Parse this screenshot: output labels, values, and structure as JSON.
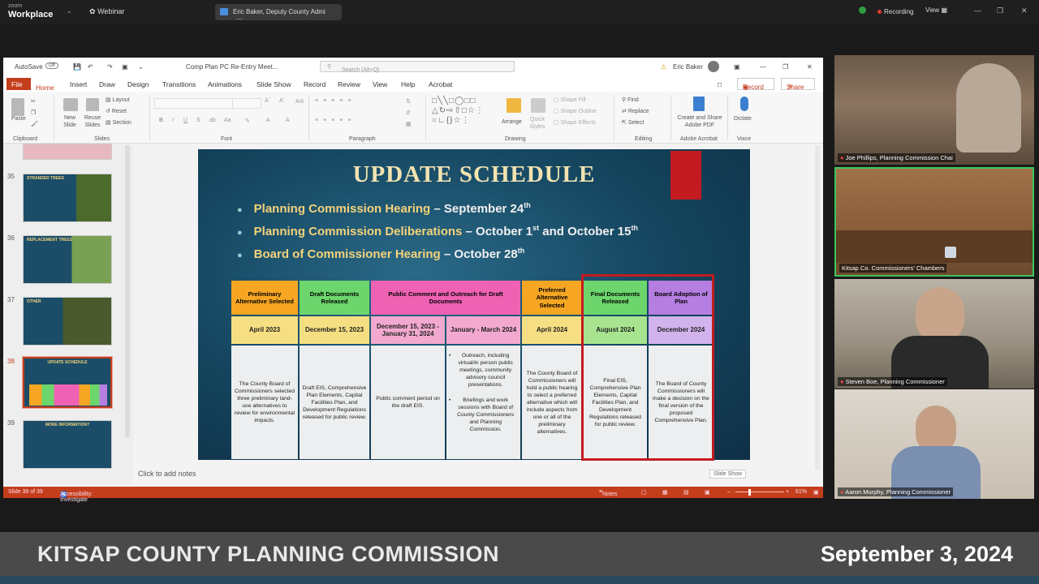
{
  "zoom": {
    "logo_top": "zoom",
    "logo_bottom": "Workplace",
    "webinar": "Webinar",
    "sharing": "Eric Baker, Deputy County Admi",
    "recording": "Recording",
    "view": "View"
  },
  "ppt": {
    "autosave": "AutoSave",
    "autosave_state": "Off",
    "file_title": "Comp Plan PC Re-Entry Meet...",
    "search_placeholder": "Search (Alt+Q)",
    "user": "Eric Baker",
    "menu": [
      "Home",
      "Insert",
      "Draw",
      "Design",
      "Transitions",
      "Animations",
      "Slide Show",
      "Record",
      "Review",
      "View",
      "Help",
      "Acrobat"
    ],
    "file_label": "File",
    "record_btn": "Record",
    "share_btn": "Share",
    "ribbon": {
      "paste": "Paste",
      "new_slide": "New Slide",
      "reuse_slides": "Reuse Slides",
      "layout": "Layout",
      "reset": "Reset",
      "section": "Section",
      "arrange": "Arrange",
      "quick_styles": "Quick Styles",
      "shape_fill": "Shape Fill",
      "shape_outline": "Shape Outline",
      "shape_effects": "Shape Effects",
      "find": "Find",
      "replace": "Replace",
      "select": "Select",
      "create_share": "Create and Share Adobe PDF",
      "dictate": "Dictate",
      "groups": [
        "Clipboard",
        "Slides",
        "Font",
        "Paragraph",
        "Drawing",
        "Editing",
        "Adobe Acrobat",
        "Voice"
      ]
    },
    "thumbs": [
      {
        "num": "35",
        "title": "STRANDED TREES"
      },
      {
        "num": "36",
        "title": "REPLACEMENT TREES"
      },
      {
        "num": "37",
        "title": "OTHER"
      },
      {
        "num": "38",
        "title": "UPDATE SCHEDULE"
      },
      {
        "num": "39",
        "title": "MORE INFORMATION?"
      }
    ],
    "notes_placeholder": "Click to add notes",
    "status_left": "Slide 38 of 39",
    "accessibility": "Accessibility: Investigate",
    "notes_btn": "Notes",
    "zoom_level": "61%",
    "slide_show_tip": "Slide Show"
  },
  "slide": {
    "title": "UPDATE SCHEDULE",
    "bullets": [
      {
        "label": "Planning Commission Hearing",
        "rest": " – September 24",
        "sup": "th",
        "tail": ""
      },
      {
        "label": "Planning Commission Deliberations",
        "rest": " – October 1",
        "sup": "st",
        "tail": " and October 15",
        "sup2": "th"
      },
      {
        "label": "Board of Commissioner Hearing",
        "rest": " – October 28",
        "sup": "th",
        "tail": ""
      }
    ],
    "table": {
      "headers": [
        "Preliminary Alternative Selected",
        "Draft Documents Released",
        "Public Comment and Outreach for Draft Documents",
        "Preferred Alternative Selected",
        "Final Documents Released",
        "Board Adoption of Plan"
      ],
      "dates": [
        "April 2023",
        "December 15, 2023",
        "December 15, 2023 - January 31, 2024",
        "January - March 2024",
        "April 2024",
        "August 2024",
        "December 2024"
      ],
      "bodies": [
        "The County Board of Commissioners selected three preliminary land-use alternatives to review for environmental impacts.",
        "Draft EIS, Comprehensive Plan Elements, Capital Facilities Plan, and Development Regulations released for public review.",
        "Public comment period on the draft EIS.",
        "Outreach, including virtual/in person public meetings, community advisory council presentations.",
        "Briefings and work sessions with Board of County Commissioners and Planning Commission.",
        "The County Board of Commissioners will hold a public hearing to select a preferred alternative which will include aspects from one or all of the preliminary alternatives.",
        "Final EIS, Comprehensive Plan Elements, Capital Facilities Plan, and Development Regulations released for public review.",
        "The Board of County Commissioners will make a decision on the final version of the proposed Comprehensive Plan."
      ]
    }
  },
  "participants": [
    {
      "name": "Joe Phillips, Planning Commission Chai"
    },
    {
      "name": "Kitsap Co. Commissioners' Chambers"
    },
    {
      "name": "Steven Boe, Planning Commissioner"
    },
    {
      "name": "Aaron Murphy, Planning Commissioner"
    }
  ],
  "banner": {
    "title": "KITSAP COUNTY PLANNING COMMISSION",
    "date": "September 3, 2024"
  },
  "colors": {
    "accent": "#c43e1c",
    "slide_bg": "#14445e",
    "highlight_red": "#c31b20",
    "orange": "#f6a623",
    "green": "#6cd66c",
    "pink": "#ef62b3",
    "purple": "#b57ee0",
    "yellow": "#f6df82"
  }
}
